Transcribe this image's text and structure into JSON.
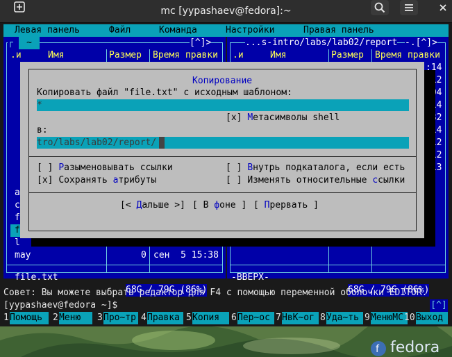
{
  "window": {
    "title": "mc [yypashaev@fedora]:~",
    "icons": {
      "new_tab": "new-tab-icon",
      "search": "search-icon",
      "menu": "hamburger-icon",
      "close": "close-icon"
    }
  },
  "menubar": [
    "Левая панель",
    "Файл",
    "Команда",
    "Настройки",
    "Правая панель"
  ],
  "left_panel": {
    "path_tilde": "~",
    "header_hint": "[^]>",
    "cols": {
      "n": ".и",
      "name": "Имя",
      "size": "Размер",
      "mtime": "Время правки"
    },
    "visible_rows": [
      {
        "name": "a",
        "size": "",
        "mtime": ""
      },
      {
        "name": "c",
        "size": "",
        "mtime": ""
      },
      {
        "name": "f",
        "size": "",
        "mtime": ""
      },
      {
        "name": "f",
        "size": "",
        "mtime": ""
      },
      {
        "name": "l",
        "size": "",
        "mtime": ""
      },
      {
        "name": "may",
        "size": "0",
        "mtime": "сен  5 15:38"
      }
    ],
    "selected_file": "file.txt",
    "disk": "68G / 79G (86%)"
  },
  "right_panel": {
    "path": "...s-intro/labs/lab02/report",
    "header_hint": "-.[^]>",
    "cols": {
      "n": ".и",
      "name": "Имя",
      "size": "Размер",
      "mtime": "Время правки"
    },
    "times": [
      ":14",
      ":12",
      ":04",
      ":14",
      ":32",
      ":14",
      ":12",
      ":12",
      ":13"
    ],
    "status": "-ВВЕРХ-",
    "disk": "68G / 79G (86%)"
  },
  "dialog": {
    "title": "Копирование",
    "source_label": "Копировать файл \"file.txt\" с исходным шаблоном:",
    "source_value": "*",
    "metachar": {
      "box": "[x]",
      "hot": "М",
      "label": "етасимволы shell"
    },
    "dest_label": "в:",
    "dest_value": "tro/labs/lab02/report/",
    "options": {
      "deref": {
        "box": "[ ]",
        "pre": "",
        "hot": "Р",
        "post": "азыменовывать ссылки"
      },
      "keep": {
        "box": "[x]",
        "pre": "Сохранять ",
        "hot": "а",
        "post": "трибуты"
      },
      "into": {
        "box": "[ ]",
        "pre": "",
        "hot": "В",
        "post": "нутрь подкаталога, если есть"
      },
      "relative": {
        "box": "[ ]",
        "pre": "Изменять относительные ",
        "hot": "с",
        "post": "сылки"
      }
    },
    "buttons": {
      "next": {
        "pre": "[< ",
        "hot": "Д",
        "post": "альше >]"
      },
      "bg": {
        "pre": "[ В ",
        "hot": "ф",
        "post": "оне ]"
      },
      "abort": {
        "pre": "[ ",
        "hot": "П",
        "post": "рервать ]"
      }
    }
  },
  "hint": "Совет: Вы можете выбрать редактор для F4 с помощью переменной оболочки EDITOR.",
  "prompt": "[yypashaev@fedora ~]$",
  "prompt_hint": "[^]",
  "fkeys": [
    {
      "n": "1",
      "label": "Помощь"
    },
    {
      "n": "2",
      "label": "Меню"
    },
    {
      "n": "3",
      "label": "Про~тр"
    },
    {
      "n": "4",
      "label": "Правка"
    },
    {
      "n": "5",
      "label": "Копия"
    },
    {
      "n": "6",
      "label": "Пер~ос"
    },
    {
      "n": "7",
      "label": "НвК~ог"
    },
    {
      "n": "8",
      "label": "Уда~ть"
    },
    {
      "n": "9",
      "label": "МенюMC"
    },
    {
      "n": "10",
      "label": "Выход"
    }
  ],
  "wallpaper": {
    "logo_text": "fedora"
  }
}
